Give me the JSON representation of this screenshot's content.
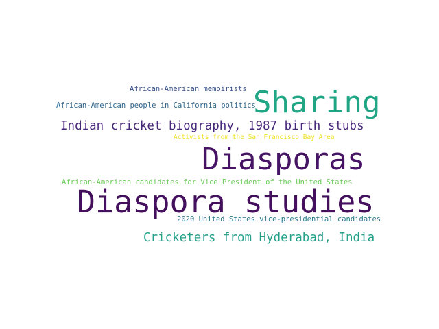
{
  "words": [
    {
      "text": "African-American memoirists",
      "color": "#3b528b"
    },
    {
      "text": "African-American people in California politics",
      "color": "#31688e"
    },
    {
      "text": "Sharing",
      "color": "#21a685"
    },
    {
      "text": "Indian cricket biography, 1987 birth stubs",
      "color": "#482979"
    },
    {
      "text": "Activists from the San Francisco Bay Area",
      "color": "#f0e11f"
    },
    {
      "text": "Diasporas",
      "color": "#471365"
    },
    {
      "text": "African-American candidates for Vice President of the United States",
      "color": "#6ccd5a"
    },
    {
      "text": "Diaspora studies",
      "color": "#440f5c"
    },
    {
      "text": "2020 United States vice-presidential candidates",
      "color": "#2a788e"
    },
    {
      "text": "Cricketers from Hyderabad, India",
      "color": "#25a18a"
    }
  ]
}
